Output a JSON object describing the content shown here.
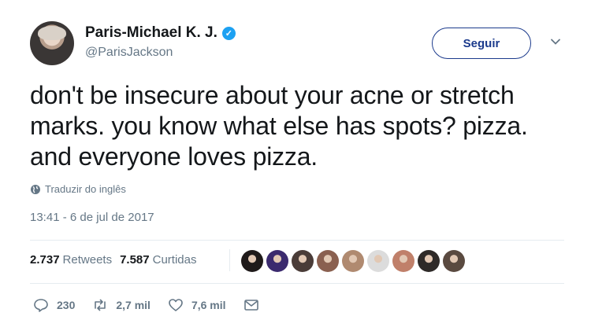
{
  "user": {
    "display_name": "Paris-Michael K. J.",
    "handle": "@ParisJackson",
    "verified_mark": "✓"
  },
  "follow_button": "Seguir",
  "tweet": {
    "text": "don't be insecure about your acne or stretch\nmarks. you know what else has spots? pizza.\nand everyone loves pizza.",
    "translate_label": "Traduzir do inglês",
    "timestamp": "13:41 - 6 de jul de 2017"
  },
  "stats": {
    "retweets_count": "2.737",
    "retweets_label": "Retweets",
    "likes_count": "7.587",
    "likes_label": "Curtidas"
  },
  "liker_avatars": [
    "#1f1a1a",
    "#3b2a6e",
    "#4a3c38",
    "#8a6050",
    "#b08a70",
    "#dcdcdc",
    "#c0806a",
    "#2e2a28",
    "#5a4a40"
  ],
  "actions": {
    "reply_count": "230",
    "retweet_count": "2,7 mil",
    "like_count": "7,6 mil"
  },
  "colors": {
    "accent": "#1b3a8c",
    "verified": "#1da1f2",
    "muted_text": "#657786",
    "divider": "#e6ecf0"
  },
  "icons": [
    "verified-badge-icon",
    "chevron-down-icon",
    "globe-icon",
    "reply-icon",
    "retweet-icon",
    "like-icon",
    "direct-message-icon"
  ]
}
